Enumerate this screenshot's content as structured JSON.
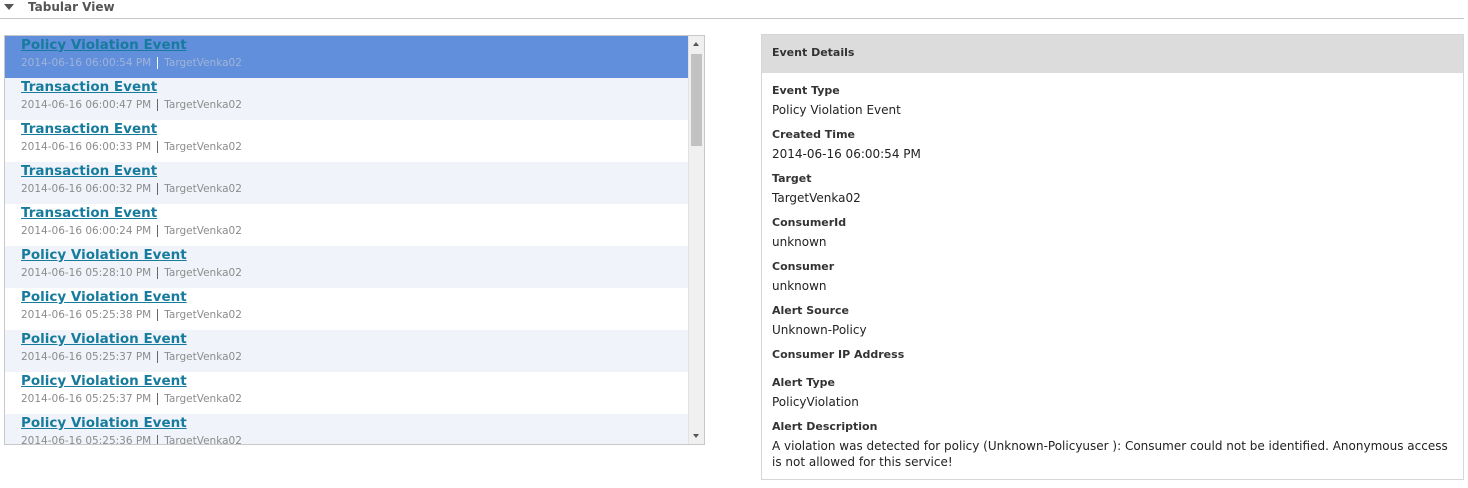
{
  "section": {
    "title": "Tabular View"
  },
  "events": [
    {
      "title": "Policy Violation Event",
      "time": "2014-06-16 06:00:54 PM",
      "target": "TargetVenka02"
    },
    {
      "title": "Transaction Event",
      "time": "2014-06-16 06:00:47 PM",
      "target": "TargetVenka02"
    },
    {
      "title": "Transaction Event",
      "time": "2014-06-16 06:00:33 PM",
      "target": "TargetVenka02"
    },
    {
      "title": "Transaction Event",
      "time": "2014-06-16 06:00:32 PM",
      "target": "TargetVenka02"
    },
    {
      "title": "Transaction Event",
      "time": "2014-06-16 06:00:24 PM",
      "target": "TargetVenka02"
    },
    {
      "title": "Policy Violation Event",
      "time": "2014-06-16 05:28:10 PM",
      "target": "TargetVenka02"
    },
    {
      "title": "Policy Violation Event",
      "time": "2014-06-16 05:25:38 PM",
      "target": "TargetVenka02"
    },
    {
      "title": "Policy Violation Event",
      "time": "2014-06-16 05:25:37 PM",
      "target": "TargetVenka02"
    },
    {
      "title": "Policy Violation Event",
      "time": "2014-06-16 05:25:37 PM",
      "target": "TargetVenka02"
    },
    {
      "title": "Policy Violation Event",
      "time": "2014-06-16 05:25:36 PM",
      "target": "TargetVenka02"
    }
  ],
  "details": {
    "title": "Event Details",
    "fields": [
      {
        "label": "Event Type",
        "value": "Policy Violation Event"
      },
      {
        "label": "Created Time",
        "value": "2014-06-16 06:00:54 PM"
      },
      {
        "label": "Target",
        "value": "TargetVenka02"
      },
      {
        "label": "ConsumerId",
        "value": "unknown"
      },
      {
        "label": "Consumer",
        "value": "unknown"
      },
      {
        "label": "Alert Source",
        "value": "Unknown-Policy"
      },
      {
        "label": "Consumer IP Address",
        "value": ""
      },
      {
        "label": "Alert Type",
        "value": "PolicyViolation"
      },
      {
        "label": "Alert Description",
        "value": "A violation was detected for policy (Unknown-Policyuser ): Consumer could not be identified. Anonymous access is not allowed for this service!"
      }
    ]
  },
  "colors": {
    "selected_row": "#628fdb",
    "alt_row": "#f0f4fa",
    "link": "#167b9c",
    "details_header": "#dcdcdc"
  }
}
